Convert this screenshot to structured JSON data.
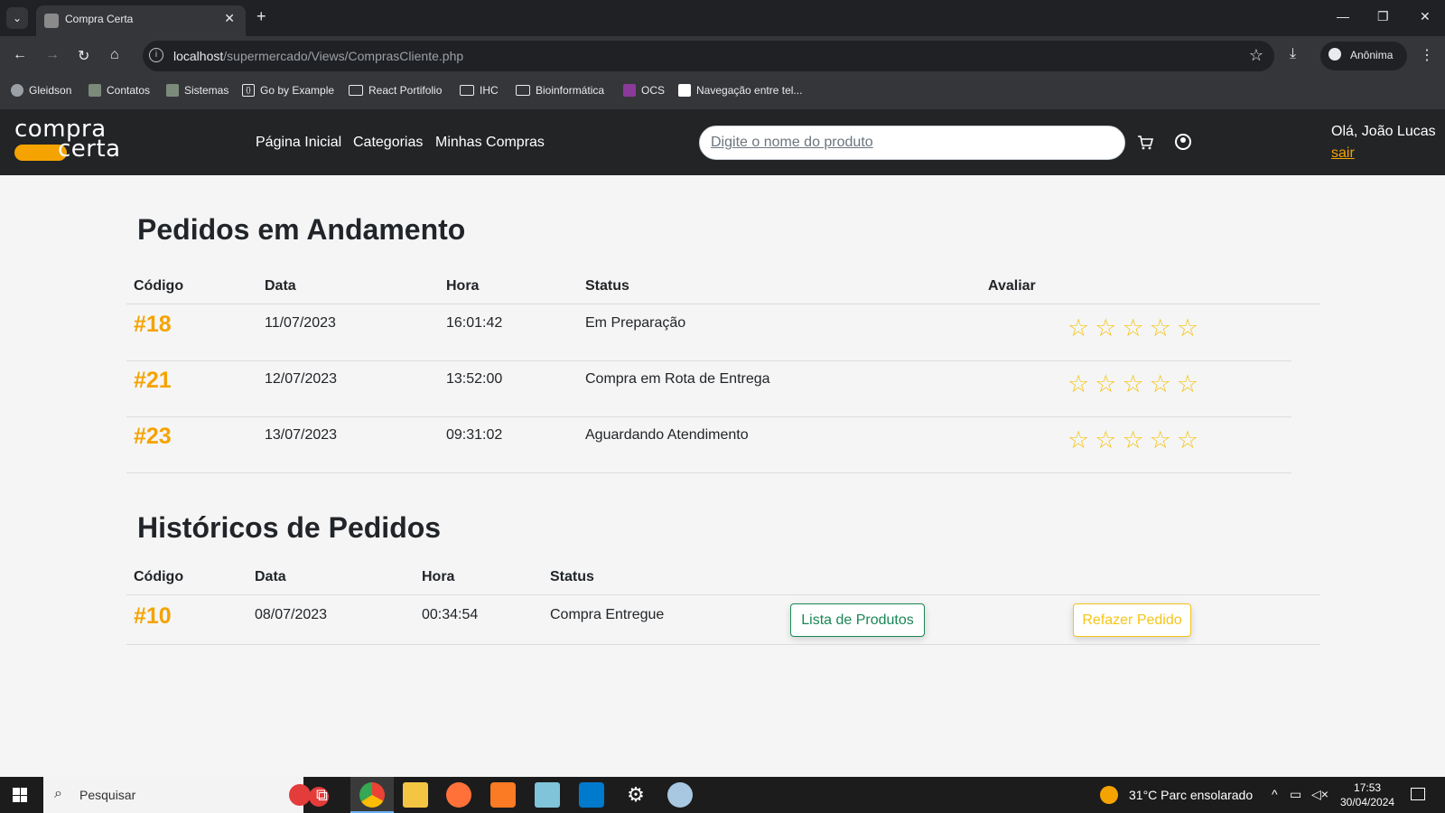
{
  "browser": {
    "tab_title": "Compra Certa",
    "url_host": "localhost",
    "url_path": "/supermercado/Views/ComprasCliente.php",
    "profile_label": "Anônima",
    "bookmarks": [
      {
        "label": "Gleidson",
        "icon": "globe-icon"
      },
      {
        "label": "Contatos",
        "icon": "doc-icon"
      },
      {
        "label": "Sistemas",
        "icon": "doc-icon"
      },
      {
        "label": "Go by Example",
        "icon": "code-icon"
      },
      {
        "label": "React Portifolio",
        "icon": "folder-icon"
      },
      {
        "label": "IHC",
        "icon": "folder-icon"
      },
      {
        "label": "Bioinformática",
        "icon": "folder-icon"
      },
      {
        "label": "OCS",
        "icon": "ocs-icon"
      },
      {
        "label": "Navegação entre tel...",
        "icon": "nav-icon"
      }
    ]
  },
  "site": {
    "logo_top": "compra",
    "logo_bottom": "certa",
    "nav": [
      "Página Inicial",
      "Categorias",
      "Minhas Compras"
    ],
    "search_placeholder": "Digite o nome do produto",
    "greeting": "Olá, João Lucas",
    "logout": "sair",
    "accent_color": "#f5a300"
  },
  "in_progress": {
    "title": "Pedidos em Andamento",
    "headers": [
      "Código",
      "Data",
      "Hora",
      "Status",
      "Avaliar"
    ],
    "rows": [
      {
        "code": "#18",
        "date": "11/07/2023",
        "time": "16:01:42",
        "status": "Em Preparação",
        "rating": 0
      },
      {
        "code": "#21",
        "date": "12/07/2023",
        "time": "13:52:00",
        "status": "Compra em Rota de Entrega",
        "rating": 0
      },
      {
        "code": "#23",
        "date": "13/07/2023",
        "time": "09:31:02",
        "status": "Aguardando Atendimento",
        "rating": 0
      }
    ],
    "max_rating": 5
  },
  "history": {
    "title": "Históricos de Pedidos",
    "headers": [
      "Código",
      "Data",
      "Hora",
      "Status"
    ],
    "rows": [
      {
        "code": "#10",
        "date": "08/07/2023",
        "time": "00:34:54",
        "status": "Compra Entregue",
        "list_button": "Lista de Produtos",
        "redo_button": "Refazer Pedido"
      }
    ]
  },
  "taskbar": {
    "search_placeholder": "Pesquisar",
    "weather": "31°C  Parc ensolarado",
    "time": "17:53",
    "date": "30/04/2024"
  }
}
